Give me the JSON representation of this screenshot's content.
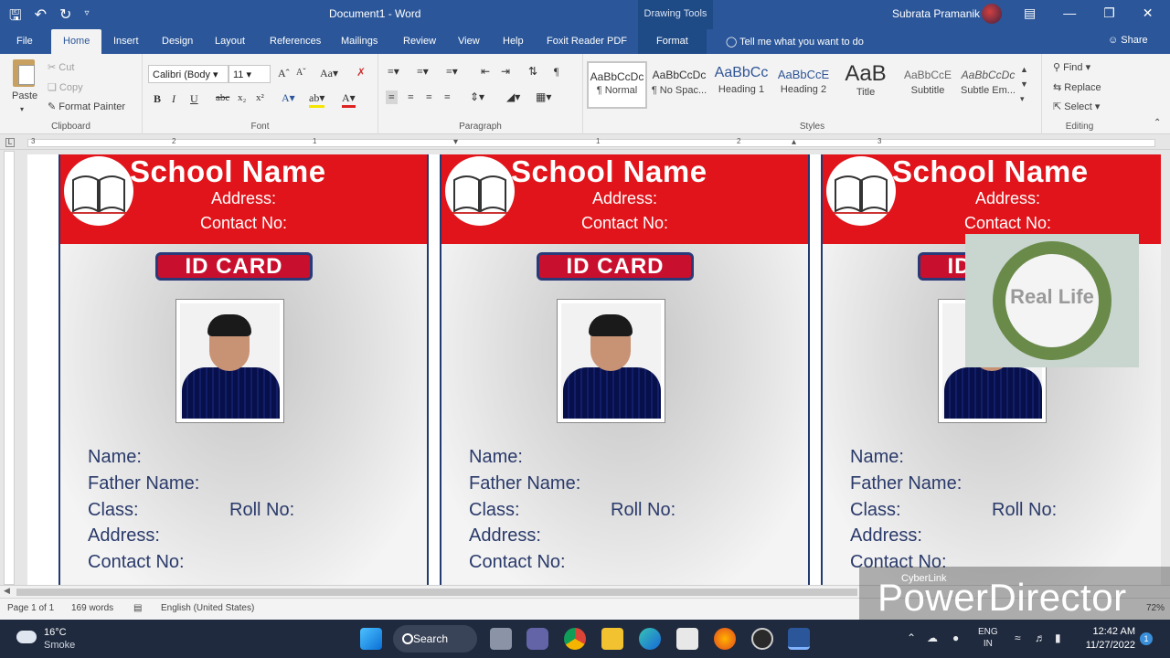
{
  "app": {
    "title": "Document1  -  Word",
    "user": "Subrata Pramanik",
    "drawing_tools": "Drawing Tools",
    "brand_color": "#2b579a"
  },
  "tabs": [
    "File",
    "Home",
    "Insert",
    "Design",
    "Layout",
    "References",
    "Mailings",
    "Review",
    "View",
    "Help",
    "Foxit Reader PDF",
    "Format"
  ],
  "tellme": "Tell me what you want to do",
  "share": "Share",
  "ribbon": {
    "clipboard": {
      "paste": "Paste",
      "cut": "Cut",
      "copy": "Copy",
      "format_painter": "Format Painter",
      "label": "Clipboard"
    },
    "font": {
      "name": "Calibri (Body",
      "size": "11",
      "label": "Font"
    },
    "paragraph": {
      "label": "Paragraph"
    },
    "styles": {
      "label": "Styles",
      "items": [
        {
          "preview": "AaBbCcDc",
          "name": "¶ Normal"
        },
        {
          "preview": "AaBbCcDc",
          "name": "¶ No Spac..."
        },
        {
          "preview": "AaBbCc",
          "name": "Heading 1"
        },
        {
          "preview": "AaBbCcE",
          "name": "Heading 2"
        },
        {
          "preview": "AaB",
          "name": "Title"
        },
        {
          "preview": "AaBbCcE",
          "name": "Subtitle"
        },
        {
          "preview": "AaBbCcDc",
          "name": "Subtle Em..."
        }
      ]
    },
    "editing": {
      "find": "Find",
      "replace": "Replace",
      "select": "Select",
      "label": "Editing"
    }
  },
  "ruler_numbers": [
    "3",
    "2",
    "1",
    "1",
    "1",
    "2",
    "3"
  ],
  "card": {
    "school_name": "School Name",
    "address": "Address:",
    "contact": "Contact No:",
    "badge": "ID CARD",
    "fields": {
      "name": "Name:",
      "father_name": "Father Name:",
      "class": "Class:",
      "roll_no": "Roll No:",
      "address": "Address:",
      "contact_no": "Contact No:"
    },
    "header_color": "#e0141a"
  },
  "watermark": "Real Life",
  "status": {
    "page": "Page 1 of 1",
    "words": "169 words",
    "language": "English (United States)",
    "zoom": "72%"
  },
  "overlay": {
    "brand_small": "CyberLink",
    "brand_large": "PowerDirector"
  },
  "taskbar": {
    "temp": "16°C",
    "weather": "Smoke",
    "search": "Search",
    "lang1": "ENG",
    "lang2": "IN",
    "time": "12:42 AM",
    "date": "11/27/2022",
    "notifications": "1"
  }
}
